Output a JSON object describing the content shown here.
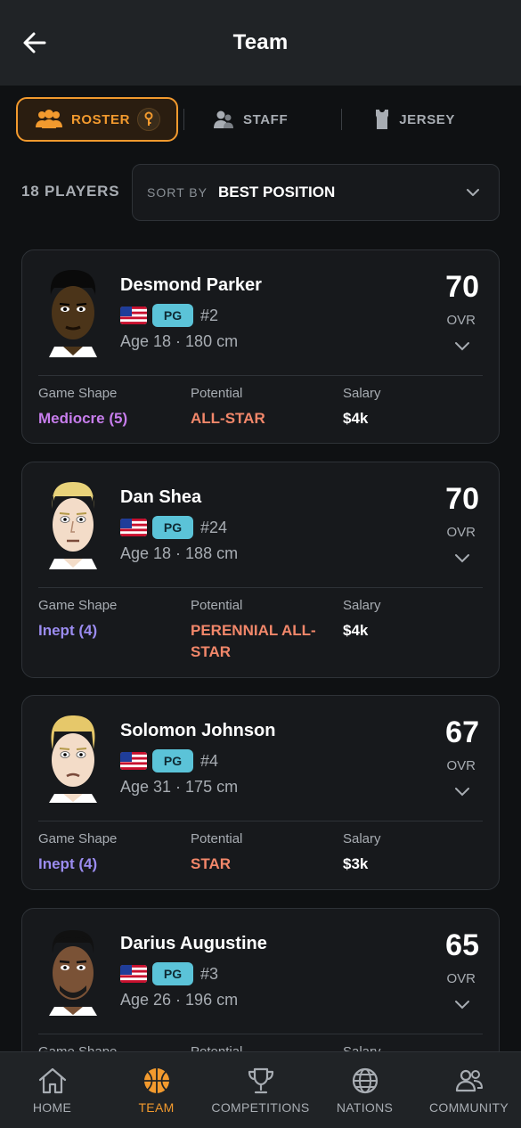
{
  "header": {
    "title": "Team"
  },
  "tabs": [
    {
      "label": "ROSTER",
      "active": true
    },
    {
      "label": "STAFF",
      "active": false
    },
    {
      "label": "JERSEY",
      "active": false
    }
  ],
  "roster": {
    "count_label": "18 PLAYERS",
    "sort_label": "SORT BY",
    "sort_value": "BEST POSITION"
  },
  "stat_labels": {
    "shape": "Game Shape",
    "potential": "Potential",
    "salary": "Salary"
  },
  "players": [
    {
      "name": "Desmond Parker",
      "position": "PG",
      "number": "#2",
      "age_height": "Age 18 · 180 cm",
      "ovr": "70",
      "ovr_label": "OVR",
      "game_shape": "Mediocre (5)",
      "potential": "ALL-STAR",
      "salary": "$4k"
    },
    {
      "name": "Dan Shea",
      "position": "PG",
      "number": "#24",
      "age_height": "Age 18 · 188 cm",
      "ovr": "70",
      "ovr_label": "OVR",
      "game_shape": "Inept (4)",
      "potential": "PERENNIAL ALL-STAR",
      "salary": "$4k"
    },
    {
      "name": "Solomon Johnson",
      "position": "PG",
      "number": "#4",
      "age_height": "Age 31 · 175 cm",
      "ovr": "67",
      "ovr_label": "OVR",
      "game_shape": "Inept (4)",
      "potential": "STAR",
      "salary": "$3k"
    },
    {
      "name": "Darius Augustine",
      "position": "PG",
      "number": "#3",
      "age_height": "Age 26 · 196 cm",
      "ovr": "65",
      "ovr_label": "OVR",
      "game_shape": "",
      "potential": "",
      "salary": ""
    }
  ],
  "colors": {
    "accent": "#f29a2e",
    "shape_mediocre": "#c77dec",
    "shape_inept": "#9b8cf0",
    "potential": "#f2876a",
    "position_badge": "#5bc3d8"
  },
  "nav": [
    {
      "label": "HOME",
      "icon": "home-icon"
    },
    {
      "label": "TEAM",
      "icon": "basketball-icon",
      "active": true
    },
    {
      "label": "COMPETITIONS",
      "icon": "trophy-icon"
    },
    {
      "label": "NATIONS",
      "icon": "globe-icon"
    },
    {
      "label": "COMMUNITY",
      "icon": "people-icon"
    }
  ]
}
